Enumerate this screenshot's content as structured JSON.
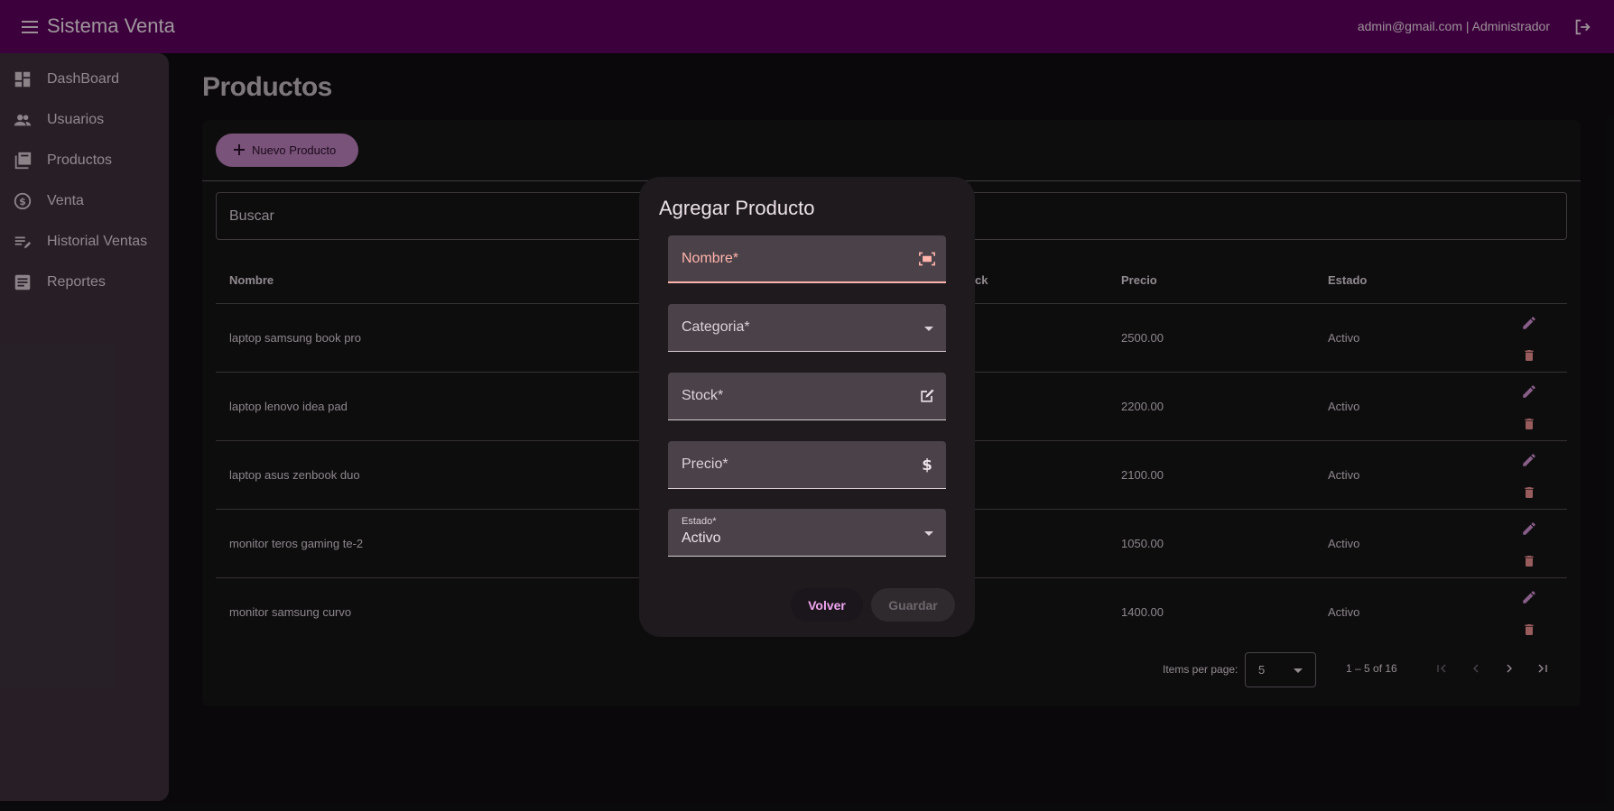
{
  "header": {
    "title": "Sistema Venta",
    "user": "admin@gmail.com | Administrador"
  },
  "sidebar": {
    "items": [
      {
        "label": "DashBoard",
        "icon": "dashboard-icon"
      },
      {
        "label": "Usuarios",
        "icon": "users-icon"
      },
      {
        "label": "Productos",
        "icon": "library-icon"
      },
      {
        "label": "Venta",
        "icon": "currency-exchange-icon"
      },
      {
        "label": "Historial Ventas",
        "icon": "playlist-edit-icon"
      },
      {
        "label": "Reportes",
        "icon": "report-icon"
      }
    ]
  },
  "page": {
    "title": "Productos",
    "new_button": "Nuevo Producto",
    "search_placeholder": "Buscar"
  },
  "table": {
    "headers": {
      "nombre": "Nombre",
      "stock": "ck",
      "precio": "Precio",
      "estado": "Estado"
    },
    "rows": [
      {
        "nombre": "laptop samsung book pro",
        "precio": "2500.00",
        "estado": "Activo"
      },
      {
        "nombre": "laptop lenovo idea pad",
        "precio": "2200.00",
        "estado": "Activo"
      },
      {
        "nombre": "laptop asus zenbook duo",
        "precio": "2100.00",
        "estado": "Activo"
      },
      {
        "nombre": "monitor teros gaming te-2",
        "precio": "1050.00",
        "estado": "Activo"
      },
      {
        "nombre": "monitor samsung curvo",
        "precio": "1400.00",
        "estado": "Activo"
      }
    ]
  },
  "paginator": {
    "label": "Items per page:",
    "page_size": "5",
    "range": "1 – 5 of 16"
  },
  "dialog": {
    "title": "Agregar Producto",
    "nombre_label": "Nombre*",
    "categoria_label": "Categoria*",
    "stock_label": "Stock*",
    "precio_label": "Precio*",
    "estado_label": "Estado*",
    "estado_value": "Activo",
    "cancel": "Volver",
    "save": "Guardar"
  },
  "colors": {
    "topbar": "#590059",
    "accent": "#b37bb3",
    "error": "#ffb4ab",
    "delete": "#e0888a"
  }
}
